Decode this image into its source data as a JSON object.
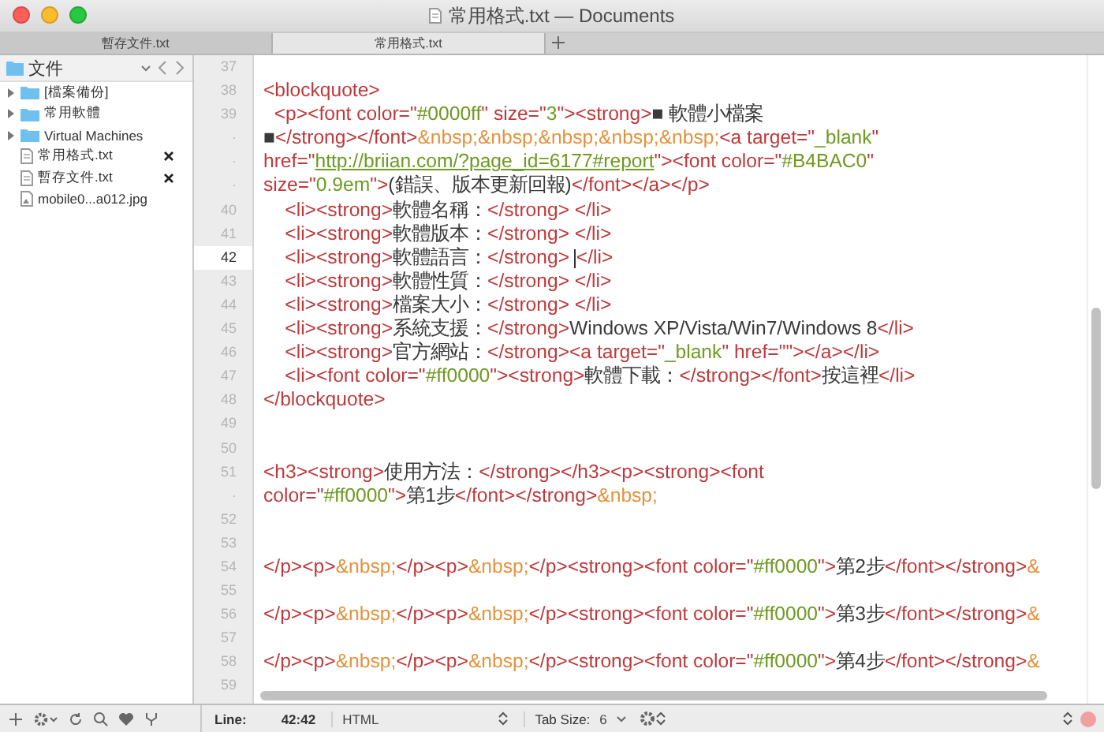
{
  "window": {
    "title": "常用格式.txt — Documents"
  },
  "tabs": [
    {
      "label": "暫存文件.txt",
      "selected": false
    },
    {
      "label": "常用格式.txt",
      "selected": true
    }
  ],
  "sidebar": {
    "title": "文件",
    "items": [
      {
        "kind": "folder",
        "label": "[檔案備份]",
        "expanded": false
      },
      {
        "kind": "folder",
        "label": "常用軟體",
        "expanded": false
      },
      {
        "kind": "folder",
        "label": "Virtual Machines",
        "expanded": false
      },
      {
        "kind": "text",
        "label": "常用格式.txt",
        "open": true
      },
      {
        "kind": "text",
        "label": "暫存文件.txt",
        "open": true
      },
      {
        "kind": "image",
        "label": "mobile0...a012.jpg",
        "open": false
      }
    ]
  },
  "editor": {
    "lines": [
      {
        "number": "37",
        "selected": false
      },
      {
        "number": "38",
        "selected": false,
        "segments": [
          {
            "kind": "tag",
            "text": "<blockquote>"
          }
        ]
      },
      {
        "number": "39",
        "selected": false,
        "segments": [
          {
            "kind": "tag",
            "text": "  <p><font color=\""
          },
          {
            "kind": "value",
            "text": "#0000ff"
          },
          {
            "kind": "tag",
            "text": "\" size=\""
          },
          {
            "kind": "value",
            "text": "3"
          },
          {
            "kind": "tag",
            "text": "\"><strong>"
          },
          {
            "kind": "text",
            "text": "■ 軟體小檔案"
          }
        ]
      },
      {
        "number": "·",
        "selected": false,
        "segments": [
          {
            "kind": "text",
            "text": "■"
          },
          {
            "kind": "tag",
            "text": "</strong></font>"
          },
          {
            "kind": "entity",
            "text": "&nbsp;&nbsp;&nbsp;&nbsp;&nbsp;"
          },
          {
            "kind": "tag",
            "text": "<a target=\""
          },
          {
            "kind": "value",
            "text": "_blank"
          },
          {
            "kind": "tag",
            "text": "\""
          }
        ]
      },
      {
        "number": "·",
        "selected": false,
        "segments": [
          {
            "kind": "tag",
            "text": "href=\""
          },
          {
            "kind": "link",
            "text": "http://briian.com/?page_id=6177#report"
          },
          {
            "kind": "tag",
            "text": "\"><font color=\""
          },
          {
            "kind": "value",
            "text": "#B4BAC0"
          },
          {
            "kind": "tag",
            "text": "\""
          }
        ]
      },
      {
        "number": "·",
        "selected": false,
        "segments": [
          {
            "kind": "tag",
            "text": "size=\""
          },
          {
            "kind": "value",
            "text": "0.9em"
          },
          {
            "kind": "tag",
            "text": "\">"
          },
          {
            "kind": "text",
            "text": "(錯誤、版本更新回報)"
          },
          {
            "kind": "tag",
            "text": "</font></a></p>"
          }
        ]
      },
      {
        "number": "40",
        "selected": false,
        "segments": [
          {
            "kind": "tag",
            "text": "    <li><strong>"
          },
          {
            "kind": "text",
            "text": "軟體名稱："
          },
          {
            "kind": "tag",
            "text": "</strong> </li>"
          }
        ]
      },
      {
        "number": "41",
        "selected": false,
        "segments": [
          {
            "kind": "tag",
            "text": "    <li><strong>"
          },
          {
            "kind": "text",
            "text": "軟體版本："
          },
          {
            "kind": "tag",
            "text": "</strong> </li>"
          }
        ]
      },
      {
        "number": "42",
        "selected": true,
        "segments": [
          {
            "kind": "tag",
            "text": "    <li><strong>"
          },
          {
            "kind": "text",
            "text": "軟體語言："
          },
          {
            "kind": "tag",
            "text": "</strong> </li>"
          }
        ]
      },
      {
        "number": "43",
        "selected": false,
        "segments": [
          {
            "kind": "tag",
            "text": "    <li><strong>"
          },
          {
            "kind": "text",
            "text": "軟體性質："
          },
          {
            "kind": "tag",
            "text": "</strong> </li>"
          }
        ]
      },
      {
        "number": "44",
        "selected": false,
        "segments": [
          {
            "kind": "tag",
            "text": "    <li><strong>"
          },
          {
            "kind": "text",
            "text": "檔案大小："
          },
          {
            "kind": "tag",
            "text": "</strong> </li>"
          }
        ]
      },
      {
        "number": "45",
        "selected": false,
        "segments": [
          {
            "kind": "tag",
            "text": "    <li><strong>"
          },
          {
            "kind": "text",
            "text": "系統支援："
          },
          {
            "kind": "tag",
            "text": "</strong>"
          },
          {
            "kind": "text",
            "text": "Windows XP/Vista/Win7/Windows 8"
          },
          {
            "kind": "tag",
            "text": "</li>"
          }
        ]
      },
      {
        "number": "46",
        "selected": false,
        "segments": [
          {
            "kind": "tag",
            "text": "    <li><strong>"
          },
          {
            "kind": "text",
            "text": "官方網站："
          },
          {
            "kind": "tag",
            "text": "</strong><a target=\""
          },
          {
            "kind": "value",
            "text": "_blank"
          },
          {
            "kind": "tag",
            "text": "\" href=\"\"></a></li>"
          }
        ]
      },
      {
        "number": "47",
        "selected": false,
        "segments": [
          {
            "kind": "tag",
            "text": "    <li><font color=\""
          },
          {
            "kind": "value",
            "text": "#ff0000"
          },
          {
            "kind": "tag",
            "text": "\"><strong>"
          },
          {
            "kind": "text",
            "text": "軟體下載："
          },
          {
            "kind": "tag",
            "text": "</strong></font>"
          },
          {
            "kind": "text",
            "text": "按這裡"
          },
          {
            "kind": "tag",
            "text": "</li>"
          }
        ]
      },
      {
        "number": "48",
        "selected": false,
        "segments": [
          {
            "kind": "tag",
            "text": "</blockquote>"
          }
        ]
      },
      {
        "number": "49",
        "selected": false
      },
      {
        "number": "50",
        "selected": false
      },
      {
        "number": "51",
        "selected": false,
        "segments": [
          {
            "kind": "tag",
            "text": "<h3><strong>"
          },
          {
            "kind": "text",
            "text": "使用方法："
          },
          {
            "kind": "tag",
            "text": "</strong></h3><p><strong><font"
          }
        ]
      },
      {
        "number": "·",
        "selected": false,
        "segments": [
          {
            "kind": "tag",
            "text": "color=\""
          },
          {
            "kind": "value",
            "text": "#ff0000"
          },
          {
            "kind": "tag",
            "text": "\">"
          },
          {
            "kind": "text",
            "text": "第1步"
          },
          {
            "kind": "tag",
            "text": "</font></strong>"
          },
          {
            "kind": "entity",
            "text": "&nbsp;"
          }
        ]
      },
      {
        "number": "52",
        "selected": false
      },
      {
        "number": "53",
        "selected": false
      },
      {
        "number": "54",
        "selected": false,
        "segments": [
          {
            "kind": "tag",
            "text": "</p><p>"
          },
          {
            "kind": "entity",
            "text": "&nbsp;"
          },
          {
            "kind": "tag",
            "text": "</p><p>"
          },
          {
            "kind": "entity",
            "text": "&nbsp;"
          },
          {
            "kind": "tag",
            "text": "</p><strong><font color=\""
          },
          {
            "kind": "value",
            "text": "#ff0000"
          },
          {
            "kind": "tag",
            "text": "\">"
          },
          {
            "kind": "text",
            "text": "第2步"
          },
          {
            "kind": "tag",
            "text": "</font></strong>"
          },
          {
            "kind": "entity",
            "text": "&"
          }
        ]
      },
      {
        "number": "55",
        "selected": false
      },
      {
        "number": "56",
        "selected": false,
        "segments": [
          {
            "kind": "tag",
            "text": "</p><p>"
          },
          {
            "kind": "entity",
            "text": "&nbsp;"
          },
          {
            "kind": "tag",
            "text": "</p><p>"
          },
          {
            "kind": "entity",
            "text": "&nbsp;"
          },
          {
            "kind": "tag",
            "text": "</p><strong><font color=\""
          },
          {
            "kind": "value",
            "text": "#ff0000"
          },
          {
            "kind": "tag",
            "text": "\">"
          },
          {
            "kind": "text",
            "text": "第3步"
          },
          {
            "kind": "tag",
            "text": "</font></strong>"
          },
          {
            "kind": "entity",
            "text": "&"
          }
        ]
      },
      {
        "number": "57",
        "selected": false
      },
      {
        "number": "58",
        "selected": false,
        "segments": [
          {
            "kind": "tag",
            "text": "</p><p>"
          },
          {
            "kind": "entity",
            "text": "&nbsp;"
          },
          {
            "kind": "tag",
            "text": "</p><p>"
          },
          {
            "kind": "entity",
            "text": "&nbsp;"
          },
          {
            "kind": "tag",
            "text": "</p><strong><font color=\""
          },
          {
            "kind": "value",
            "text": "#ff0000"
          },
          {
            "kind": "tag",
            "text": "\">"
          },
          {
            "kind": "text",
            "text": "第4步"
          },
          {
            "kind": "tag",
            "text": "</font></strong>"
          },
          {
            "kind": "entity",
            "text": "&"
          }
        ]
      },
      {
        "number": "59",
        "selected": false
      }
    ]
  },
  "status_bar": {
    "line_label": "Line:",
    "position": "42:42",
    "syntax": "HTML",
    "tab_size_label": "Tab Size:",
    "tab_size": "6"
  }
}
